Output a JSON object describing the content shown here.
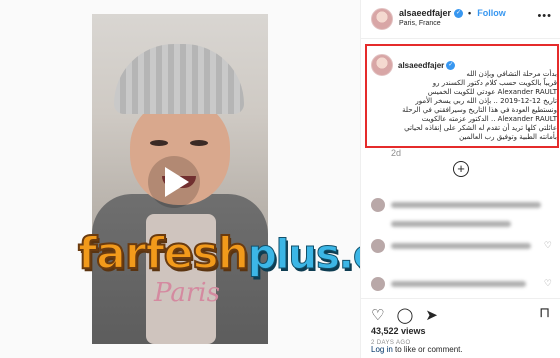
{
  "post": {
    "username": "alsaeedfajer",
    "follow_label": "Follow",
    "separator": "•",
    "location": "Paris, France",
    "more_label": "•••"
  },
  "caption": {
    "username": "alsaeedfajer",
    "lines": [
      "بدأت مرحلة التشافي وبإذن الله",
      "قريباً بالكويت حسب كلام دكتور الكسندر رو",
      "Alexander RAULT عودتي للكويت الخميس",
      "تاريخ 12-12-2019 .. بإذن الله ربي يسخر الأمور",
      "ونستطيع العودة في هذا التاريخ وسيرافقني في الرحلة",
      "Alexander RAULT .. الدكتور عزمته عالكويت",
      "عائلتي كلها تريد أن تقدم له الشكر على إنقاذه لحياتي",
      "بأمانته الطبية وتوفيق رب العالمين"
    ],
    "time": "2d"
  },
  "watermark": {
    "main": "farfesh",
    "sub": "plus.com"
  },
  "video": {
    "shirt_text": "Paris"
  },
  "stats": {
    "views": "43,522 views",
    "posted": "2 DAYS AGO"
  },
  "login": {
    "link": "Log in",
    "rest": " to like or comment."
  },
  "icons": {
    "verified": "✓",
    "add_comment": "+",
    "like": "♡",
    "comment": "◯",
    "share": "➤",
    "bookmark": "⊓",
    "heart_small": "♡"
  }
}
